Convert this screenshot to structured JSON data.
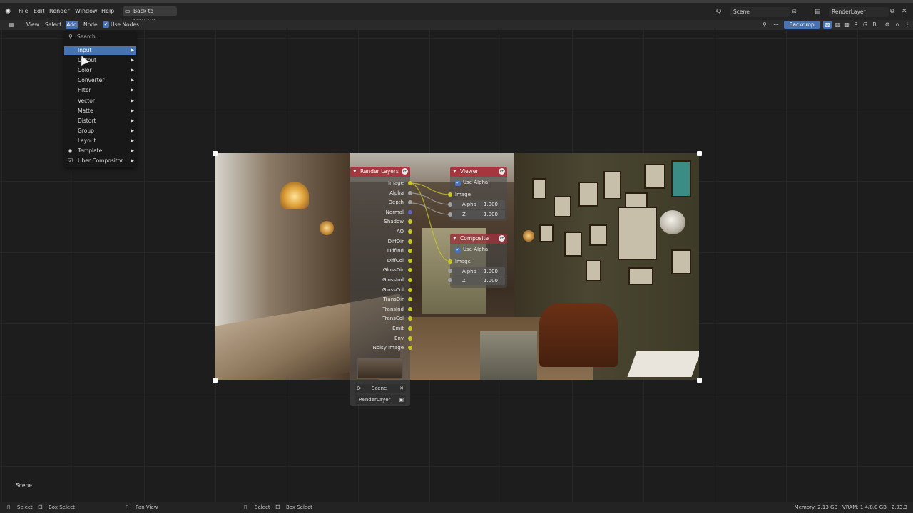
{
  "topbar": {
    "menu": [
      "File",
      "Edit",
      "Render",
      "Window",
      "Help"
    ],
    "back_button": "Back to Previous",
    "scene_field": "Scene",
    "view_layer_field": "RenderLayer"
  },
  "header": {
    "menu": [
      "View",
      "Select",
      "Add",
      "Node"
    ],
    "use_nodes_label": "Use Nodes",
    "use_nodes_checked": true,
    "backdrop_label": "Backdrop"
  },
  "add_menu": {
    "search_placeholder": "Search...",
    "items": [
      {
        "label": "Input",
        "active": true,
        "submenu": true
      },
      {
        "label": "Output",
        "submenu": true
      },
      {
        "label": "Color",
        "submenu": true
      },
      {
        "label": "Converter",
        "submenu": true
      },
      {
        "label": "Filter",
        "submenu": true
      },
      {
        "label": "Vector",
        "submenu": true
      },
      {
        "label": "Matte",
        "submenu": true
      },
      {
        "label": "Distort",
        "submenu": true
      },
      {
        "label": "Group",
        "submenu": true
      },
      {
        "label": "Layout",
        "submenu": true
      },
      {
        "label": "Template",
        "submenu": true,
        "icon": "template-icon"
      },
      {
        "label": "Uber Compositor",
        "submenu": true,
        "icon": "checkbox-icon"
      }
    ]
  },
  "render_layers_node": {
    "title": "Render Layers",
    "outputs": [
      "Image",
      "Alpha",
      "Depth",
      "Normal",
      "Shadow",
      "AO",
      "DiffDir",
      "DiffInd",
      "DiffCol",
      "GlossDir",
      "GlossInd",
      "GlossCol",
      "TransDir",
      "TransInd",
      "TransCol",
      "Emit",
      "Env",
      "Noisy Image"
    ],
    "scene": "Scene",
    "layer": "RenderLayer"
  },
  "viewer_node": {
    "title": "Viewer",
    "use_alpha_label": "Use Alpha",
    "inputs": {
      "image": "Image",
      "alpha_label": "Alpha",
      "alpha_value": "1.000",
      "z_label": "Z",
      "z_value": "1.000"
    }
  },
  "composite_node": {
    "title": "Composite",
    "use_alpha_label": "Use Alpha",
    "inputs": {
      "image": "Image",
      "alpha_label": "Alpha",
      "alpha_value": "1.000",
      "z_label": "Z",
      "z_value": "1.000"
    }
  },
  "scene_label": "Scene",
  "statusbar": {
    "left": [
      "Select",
      "Box Select",
      "Pan View"
    ],
    "mid": [
      "Select",
      "Box Select"
    ],
    "right": "Memory: 2.13 GB | VRAM: 1.4/8.0 GB | 2.93.3"
  },
  "colors": {
    "accent": "#4772b3",
    "node_header": "#af2d37",
    "socket_color": "#c7c729",
    "socket_float": "#a1a1a1",
    "socket_vector": "#6363c7"
  }
}
